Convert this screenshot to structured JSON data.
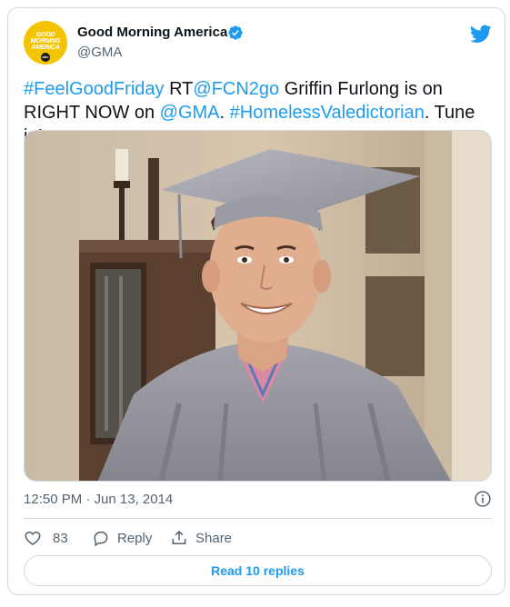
{
  "account": {
    "display_name": "Good Morning America",
    "handle": "@GMA",
    "avatar_text": [
      "GOOD",
      "MORNING",
      "AMERICA"
    ],
    "avatar_badge": "abc",
    "verified": true
  },
  "tweet": {
    "text_parts": [
      {
        "text": "#FeelGoodFriday",
        "link": true
      },
      {
        "text": " RT",
        "link": false
      },
      {
        "text": "@FCN2go",
        "link": true
      },
      {
        "text": " Griffin Furlong is on RIGHT NOW on ",
        "link": false
      },
      {
        "text": "@GMA",
        "link": true
      },
      {
        "text": ". ",
        "link": false
      },
      {
        "text": "#HomelessValedictorian",
        "link": true
      },
      {
        "text": ". Tune in!",
        "link": false
      }
    ],
    "timestamp": "12:50 PM · Jun 13, 2014"
  },
  "actions": {
    "like_count": "83",
    "reply_label": "Reply",
    "share_label": "Share"
  },
  "read_replies_label": "Read 10 replies",
  "icons": {
    "platform": "twitter-bird-icon",
    "verified": "verified-badge-icon",
    "info": "info-icon",
    "like": "heart-icon",
    "reply": "reply-bubble-icon",
    "share": "share-icon"
  },
  "colors": {
    "link": "#1d9bf0",
    "secondary_text": "#536471",
    "border": "#cfd9de",
    "avatar_bg": "#f5c400"
  }
}
